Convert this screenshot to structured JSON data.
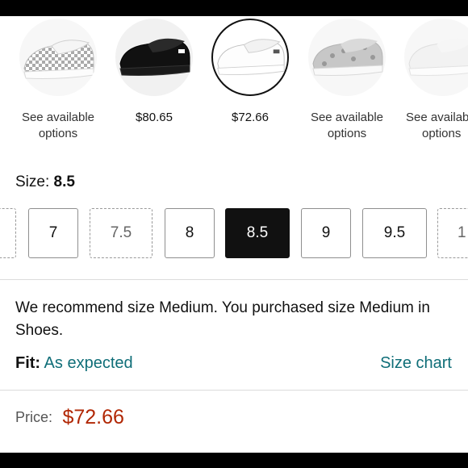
{
  "swatches": [
    {
      "label_line1": "See available",
      "label_line2": "options",
      "style": "checkerboard",
      "state": "dim"
    },
    {
      "label_line1": "$80.65",
      "label_line2": "",
      "style": "black",
      "state": "normal"
    },
    {
      "label_line1": "$72.66",
      "label_line2": "",
      "style": "white",
      "state": "selected"
    },
    {
      "label_line1": "See available",
      "label_line2": "options",
      "style": "leopard",
      "state": "dim"
    },
    {
      "label_line1": "See availab",
      "label_line2": "options",
      "style": "plain",
      "state": "dim"
    }
  ],
  "size": {
    "label": "Size:",
    "selected": "8.5",
    "options": [
      {
        "label": "",
        "available": false
      },
      {
        "label": "7",
        "available": true
      },
      {
        "label": "7.5",
        "available": false
      },
      {
        "label": "8",
        "available": true
      },
      {
        "label": "8.5",
        "available": true,
        "selected": true
      },
      {
        "label": "9",
        "available": true
      },
      {
        "label": "9.5",
        "available": true
      },
      {
        "label": "1",
        "available": false
      }
    ]
  },
  "recommendation": {
    "text": "We recommend size Medium. You purchased size Medium in Shoes."
  },
  "fit": {
    "label": "Fit:",
    "value": "As expected",
    "size_chart_link": "Size chart"
  },
  "price": {
    "label": "Price:",
    "value": "$72.66"
  },
  "colors": {
    "price": "#b12704",
    "link": "#0f6e78",
    "selected_size_bg": "#111111"
  }
}
